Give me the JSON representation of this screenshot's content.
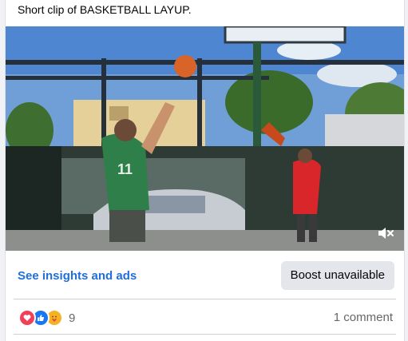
{
  "post": {
    "caption": "Short clip of BASKETBALL LAYUP.",
    "video": {
      "description_icon": "play-video",
      "mute_icon": "volume-muted-icon"
    }
  },
  "actions": {
    "insights_label": "See insights and ads",
    "boost_label": "Boost unavailable"
  },
  "stats": {
    "reactions": [
      "love-icon",
      "like-icon",
      "care-icon"
    ],
    "reaction_count": "9",
    "comments_label": "1 comment"
  },
  "colors": {
    "link": "#216fdb",
    "love": "#f33e58",
    "like": "#1877f2",
    "care": "#f7b125"
  }
}
